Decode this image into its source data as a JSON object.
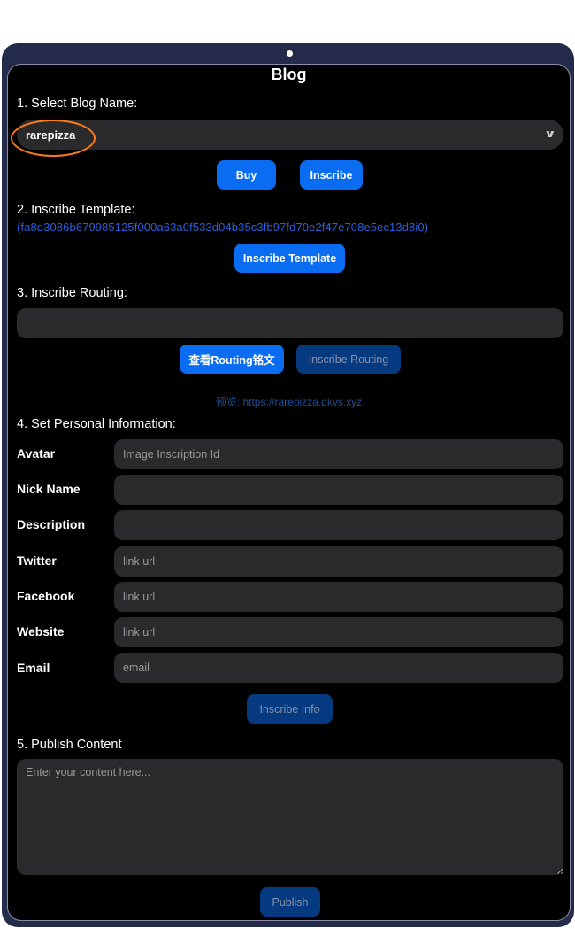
{
  "app": {
    "title": "Blog"
  },
  "section1": {
    "label": "1. Select Blog Name:",
    "selected_blog": "rarepizza",
    "buy_label": "Buy",
    "inscribe_label": "Inscribe"
  },
  "section2": {
    "label": "2. Inscribe Template:",
    "template_id": "(fa8d3086b679985125f000a63a0f533d04b35c3fb97fd70e2f47e708e5ec13d8i0)",
    "button_label": "Inscribe Template"
  },
  "section3": {
    "label": "3. Inscribe Routing:",
    "routing_value": "",
    "view_button_label": "查看Routing铭文",
    "inscribe_button_label": "Inscribe Routing",
    "preview_text": "预览: https://rarepizza.dkvs.xyz"
  },
  "section4": {
    "label": "4. Set Personal Information:",
    "fields": [
      {
        "label": "Avatar",
        "placeholder": "Image Inscription Id",
        "value": ""
      },
      {
        "label": "Nick Name",
        "placeholder": "",
        "value": ""
      },
      {
        "label": "Description",
        "placeholder": "",
        "value": ""
      },
      {
        "label": "Twitter",
        "placeholder": "link url",
        "value": ""
      },
      {
        "label": "Facebook",
        "placeholder": "link url",
        "value": ""
      },
      {
        "label": "Website",
        "placeholder": "link url",
        "value": ""
      },
      {
        "label": "Email",
        "placeholder": "email",
        "value": ""
      }
    ],
    "button_label": "Inscribe Info"
  },
  "section5": {
    "label": "5. Publish Content",
    "content_placeholder": "Enter your content here...",
    "content_value": "",
    "button_label": "Publish"
  },
  "icons": {
    "dropdown": "chevron-down-icon"
  },
  "colors": {
    "primary": "#0a6cf0",
    "disabled": "#063a80",
    "link": "#2a5fdc",
    "highlight": "#ff7a1a",
    "frame": "#232a4a"
  }
}
